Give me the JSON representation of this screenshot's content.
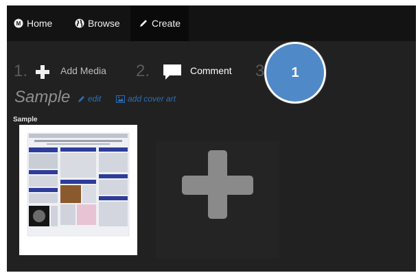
{
  "nav": {
    "home_label": "Home",
    "browse_label": "Browse",
    "create_label": "Create"
  },
  "steps": [
    {
      "number": "1.",
      "label": "Add Media"
    },
    {
      "number": "2.",
      "label": "Comment"
    },
    {
      "number": "3",
      "label": ""
    }
  ],
  "collection": {
    "title": "Sample",
    "edit_label": "edit",
    "cover_label": "add cover art",
    "item_label": "Sample"
  },
  "callout": {
    "number": "1"
  },
  "colors": {
    "frame_bg": "#212121",
    "navbar_bg": "#131313",
    "link": "#2a6fb5",
    "callout": "#4f89c8",
    "plus_tile": "#8a8a8a"
  },
  "icons": {
    "home": "home-icon",
    "browse": "globe-icon",
    "create": "pencil-icon",
    "add_media": "plus-icon",
    "comment": "speech-bubble-icon",
    "edit": "pencil-icon",
    "cover_art": "image-icon",
    "add_tile": "plus-icon"
  }
}
